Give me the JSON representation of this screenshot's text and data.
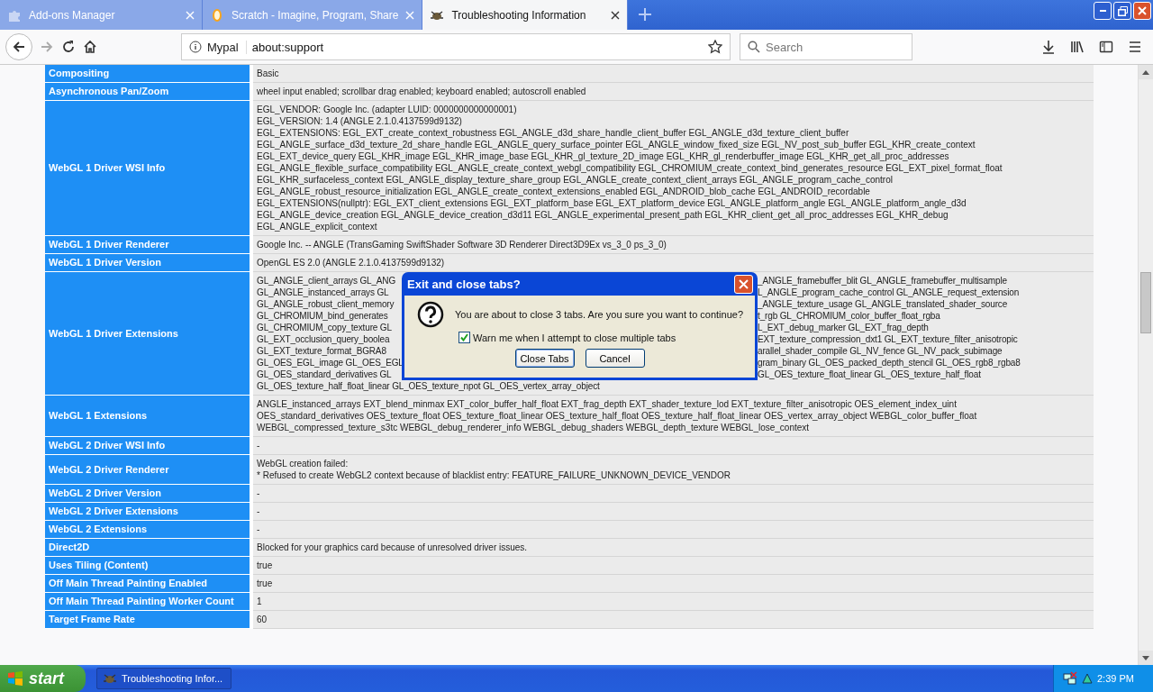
{
  "tabs": [
    {
      "title": "Add-ons Manager",
      "selected": false
    },
    {
      "title": "Scratch - Imagine, Program, Share",
      "selected": false
    },
    {
      "title": "Troubleshooting Information",
      "selected": true
    }
  ],
  "toolbar": {
    "identity": "Mypal",
    "url": "about:support",
    "search_placeholder": "Search"
  },
  "table": {
    "rows": [
      {
        "label": "Compositing",
        "lines": [
          "Basic"
        ]
      },
      {
        "label": "Asynchronous Pan/Zoom",
        "lines": [
          "wheel input enabled; scrollbar drag enabled; keyboard enabled; autoscroll enabled"
        ]
      },
      {
        "label": "WebGL 1 Driver WSI Info",
        "lines": [
          "EGL_VENDOR: Google Inc. (adapter LUID: 0000000000000001)",
          "EGL_VERSION: 1.4 (ANGLE 2.1.0.4137599d9132)",
          "EGL_EXTENSIONS: EGL_EXT_create_context_robustness EGL_ANGLE_d3d_share_handle_client_buffer EGL_ANGLE_d3d_texture_client_buffer",
          "EGL_ANGLE_surface_d3d_texture_2d_share_handle EGL_ANGLE_query_surface_pointer EGL_ANGLE_window_fixed_size EGL_NV_post_sub_buffer EGL_KHR_create_context",
          "EGL_EXT_device_query EGL_KHR_image EGL_KHR_image_base EGL_KHR_gl_texture_2D_image EGL_KHR_gl_renderbuffer_image EGL_KHR_get_all_proc_addresses",
          "EGL_ANGLE_flexible_surface_compatibility EGL_ANGLE_create_context_webgl_compatibility EGL_CHROMIUM_create_context_bind_generates_resource EGL_EXT_pixel_format_float",
          "EGL_KHR_surfaceless_context EGL_ANGLE_display_texture_share_group EGL_ANGLE_create_context_client_arrays EGL_ANGLE_program_cache_control",
          "EGL_ANGLE_robust_resource_initialization EGL_ANGLE_create_context_extensions_enabled EGL_ANDROID_blob_cache EGL_ANDROID_recordable",
          "EGL_EXTENSIONS(nullptr): EGL_EXT_client_extensions EGL_EXT_platform_base EGL_EXT_platform_device EGL_ANGLE_platform_angle EGL_ANGLE_platform_angle_d3d",
          "EGL_ANGLE_device_creation EGL_ANGLE_device_creation_d3d11 EGL_ANGLE_experimental_present_path EGL_KHR_client_get_all_proc_addresses EGL_KHR_debug",
          "EGL_ANGLE_explicit_context"
        ]
      },
      {
        "label": "WebGL 1 Driver Renderer",
        "lines": [
          "Google Inc. -- ANGLE (TransGaming SwiftShader Software 3D Renderer Direct3D9Ex vs_3_0 ps_3_0)"
        ]
      },
      {
        "label": "WebGL 1 Driver Version",
        "lines": [
          "OpenGL ES 2.0 (ANGLE 2.1.0.4137599d9132)"
        ]
      },
      {
        "label": "WebGL 1 Driver Extensions",
        "kind": "split",
        "lines": [
          {
            "left": "GL_ANGLE_client_arrays GL_ANG",
            "right": "_ANGLE_framebuffer_blit GL_ANGLE_framebuffer_multisample"
          },
          {
            "left": "GL_ANGLE_instanced_arrays GL",
            "right": "L_ANGLE_program_cache_control GL_ANGLE_request_extension"
          },
          {
            "left": "GL_ANGLE_robust_client_memory",
            "right": "_ANGLE_texture_usage GL_ANGLE_translated_shader_source"
          },
          {
            "left": "GL_CHROMIUM_bind_generates",
            "right": "t_rgb GL_CHROMIUM_color_buffer_float_rgba"
          },
          {
            "left": "GL_CHROMIUM_copy_texture GL",
            "right": "L_EXT_debug_marker GL_EXT_frag_depth"
          },
          {
            "left": "GL_EXT_occlusion_query_boolea",
            "right": "EXT_texture_compression_dxt1 GL_EXT_texture_filter_anisotropic"
          },
          {
            "left": "GL_EXT_texture_format_BGRA8",
            "right": "arallel_shader_compile GL_NV_fence GL_NV_pack_subimage"
          },
          {
            "left": "GL_OES_EGL_image GL_OES_EGL",
            "right": "gram_binary GL_OES_packed_depth_stencil GL_OES_rgb8_rgba8"
          },
          {
            "left": "GL_OES_standard_derivatives GL",
            "right": "GL_OES_texture_float_linear GL_OES_texture_half_float"
          },
          {
            "left": "GL_OES_texture_half_float_linear GL_OES_texture_npot GL_OES_vertex_array_object"
          }
        ]
      },
      {
        "label": "WebGL 1 Extensions",
        "lines": [
          "ANGLE_instanced_arrays EXT_blend_minmax EXT_color_buffer_half_float EXT_frag_depth EXT_shader_texture_lod EXT_texture_filter_anisotropic OES_element_index_uint",
          "OES_standard_derivatives OES_texture_float OES_texture_float_linear OES_texture_half_float OES_texture_half_float_linear OES_vertex_array_object WEBGL_color_buffer_float",
          "WEBGL_compressed_texture_s3tc WEBGL_debug_renderer_info WEBGL_debug_shaders WEBGL_depth_texture WEBGL_lose_context"
        ]
      },
      {
        "label": "WebGL 2 Driver WSI Info",
        "lines": [
          "-"
        ]
      },
      {
        "label": "WebGL 2 Driver Renderer",
        "lines": [
          "WebGL creation failed:",
          "* Refused to create WebGL2 context because of blacklist entry: FEATURE_FAILURE_UNKNOWN_DEVICE_VENDOR"
        ]
      },
      {
        "label": "WebGL 2 Driver Version",
        "lines": [
          "-"
        ]
      },
      {
        "label": "WebGL 2 Driver Extensions",
        "lines": [
          "-"
        ]
      },
      {
        "label": "WebGL 2 Extensions",
        "lines": [
          "-"
        ]
      },
      {
        "label": "Direct2D",
        "lines": [
          "Blocked for your graphics card because of unresolved driver issues."
        ]
      },
      {
        "label": "Uses Tiling (Content)",
        "lines": [
          "true"
        ]
      },
      {
        "label": "Off Main Thread Painting Enabled",
        "lines": [
          "true"
        ]
      },
      {
        "label": "Off Main Thread Painting Worker Count",
        "lines": [
          "1"
        ]
      },
      {
        "label": "Target Frame Rate",
        "lines": [
          "60"
        ]
      }
    ]
  },
  "dialog": {
    "title": "Exit and close tabs?",
    "message": "You are about to close 3 tabs. Are you sure you want to continue?",
    "checkbox": {
      "label": "Warn me when I attempt to close multiple tabs",
      "checked": true
    },
    "buttons": [
      {
        "label": "Close Tabs",
        "default": true
      },
      {
        "label": "Cancel",
        "default": false
      }
    ]
  },
  "taskbar": {
    "start": "start",
    "tasks": [
      {
        "title": "Troubleshooting Infor..."
      }
    ],
    "clock": "2:39 PM"
  }
}
